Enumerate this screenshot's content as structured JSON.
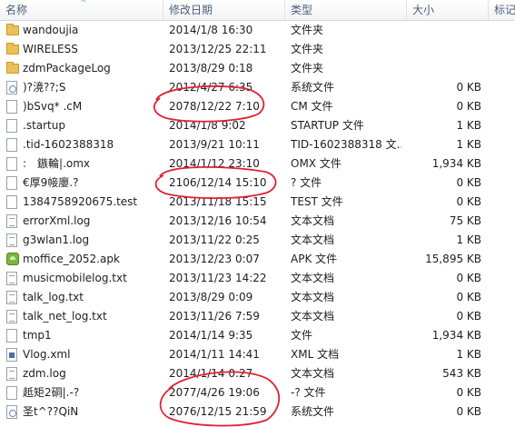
{
  "columns": {
    "name": "名称",
    "date": "修改日期",
    "type": "类型",
    "size": "大小",
    "tags": "标记"
  },
  "annotation_color": "#e0232f",
  "files": [
    {
      "icon": "folder-icon",
      "name": "wandoujia",
      "date": "2014/1/8 16:30",
      "type": "文件夹",
      "size": ""
    },
    {
      "icon": "folder-icon",
      "name": "WIRELESS",
      "date": "2013/12/25 22:11",
      "type": "文件夹",
      "size": ""
    },
    {
      "icon": "folder-icon",
      "name": "zdmPackageLog",
      "date": "2013/8/29 0:18",
      "type": "文件夹",
      "size": ""
    },
    {
      "icon": "system-file-icon",
      "name": ")?滰??;S",
      "date": "2012/4/27 6:35",
      "type": "系统文件",
      "size": "0 KB"
    },
    {
      "icon": "file-icon",
      "name": ")bSvq* .cM",
      "date": "2078/12/22 7:10",
      "type": "CM 文件",
      "size": "0 KB"
    },
    {
      "icon": "file-icon",
      "name": ".startup",
      "date": "2014/1/8 9:02",
      "type": "STARTUP 文件",
      "size": "1 KB"
    },
    {
      "icon": "file-icon",
      "name": ".tid-1602388318",
      "date": "2013/9/21 10:11",
      "type": "TID-1602388318 文...",
      "size": "1 KB"
    },
    {
      "icon": "file-icon",
      "name": ":　鏃輪|.omx",
      "date": "2014/1/12 23:10",
      "type": "OMX 文件",
      "size": "1,934 KB"
    },
    {
      "icon": "file-icon",
      "name": "€厚9帹廮.?",
      "date": "2106/12/14 15:10",
      "type": "? 文件",
      "size": "0 KB"
    },
    {
      "icon": "file-icon",
      "name": "1384758920675.test",
      "date": "2013/11/18 15:15",
      "type": "TEST 文件",
      "size": "0 KB"
    },
    {
      "icon": "document-icon",
      "name": "errorXml.log",
      "date": "2013/12/16 10:54",
      "type": "文本文档",
      "size": "75 KB"
    },
    {
      "icon": "document-icon",
      "name": "g3wlan1.log",
      "date": "2013/11/22 0:25",
      "type": "文本文档",
      "size": "1 KB"
    },
    {
      "icon": "apk-icon",
      "name": "moffice_2052.apk",
      "date": "2013/12/23 0:07",
      "type": "APK 文件",
      "size": "15,895 KB"
    },
    {
      "icon": "document-icon",
      "name": "musicmobilelog.txt",
      "date": "2013/11/23 14:22",
      "type": "文本文档",
      "size": "0 KB"
    },
    {
      "icon": "document-icon",
      "name": "talk_log.txt",
      "date": "2013/8/29 0:09",
      "type": "文本文档",
      "size": "0 KB"
    },
    {
      "icon": "document-icon",
      "name": "talk_net_log.txt",
      "date": "2013/11/26 7:59",
      "type": "文本文档",
      "size": "0 KB"
    },
    {
      "icon": "file-icon",
      "name": "tmp1",
      "date": "2014/1/14 9:35",
      "type": "文件",
      "size": "1,934 KB"
    },
    {
      "icon": "xml-file-icon",
      "name": "Vlog.xml",
      "date": "2014/1/11 14:41",
      "type": "XML 文档",
      "size": "1 KB"
    },
    {
      "icon": "document-icon",
      "name": "zdm.log",
      "date": "2014/1/14 0:27",
      "type": "文本文档",
      "size": "543 KB"
    },
    {
      "icon": "file-icon",
      "name": "赿矩2硐|.-?",
      "date": "2077/4/26 19:06",
      "type": "-? 文件",
      "size": "0 KB"
    },
    {
      "icon": "system-file-icon",
      "name": "圣t^??QiN",
      "date": "2076/12/15 21:59",
      "type": "系统文件",
      "size": "0 KB"
    }
  ]
}
